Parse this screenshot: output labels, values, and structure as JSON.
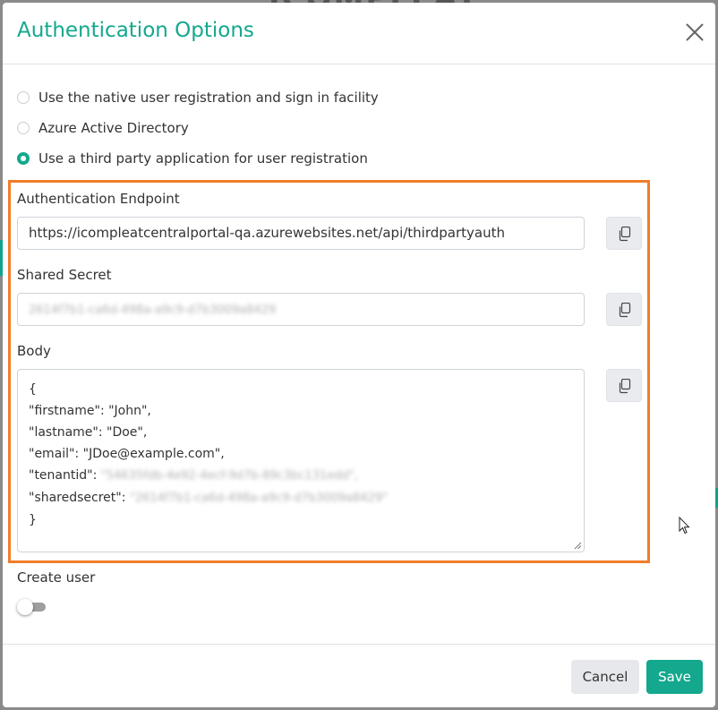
{
  "modal": {
    "title": "Authentication Options"
  },
  "auth_options": [
    {
      "label": "Use the native user registration and sign in facility",
      "checked": false
    },
    {
      "label": "Azure Active Directory",
      "checked": false
    },
    {
      "label": "Use a third party application for user registration",
      "checked": true
    }
  ],
  "endpoint": {
    "label": "Authentication Endpoint",
    "value": "https://icompleatcentralportal-qa.azurewebsites.net/api/thirdpartyauth"
  },
  "shared_secret": {
    "label": "Shared Secret",
    "value": "2614f7b1-ca6d-498a-a9c9-d7b3009a8429"
  },
  "body": {
    "label": "Body",
    "lines": [
      "{",
      "\"firstname\": \"John\",",
      "\"lastname\": \"Doe\",",
      "\"email\": \"JDoe@example.com\","
    ],
    "tenantid_key": "\"tenantid\": ",
    "tenantid_value": "\"54635fdb-4e92-4ecf-9d7b-89c3bc131edd\",",
    "sharedsecret_key": "\"sharedsecret\": ",
    "sharedsecret_value": "\"2614f7b1-ca6d-498a-a9c9-d7b3009a8429\"",
    "closing": "}"
  },
  "create_user": {
    "label": "Create user",
    "enabled": false
  },
  "footer": {
    "cancel_label": "Cancel",
    "save_label": "Save"
  },
  "colors": {
    "accent": "#14a88e",
    "highlight": "#f07d2b"
  },
  "icons": [
    "close-icon",
    "copy-icon",
    "resize-grip-icon",
    "mouse-cursor-icon"
  ]
}
